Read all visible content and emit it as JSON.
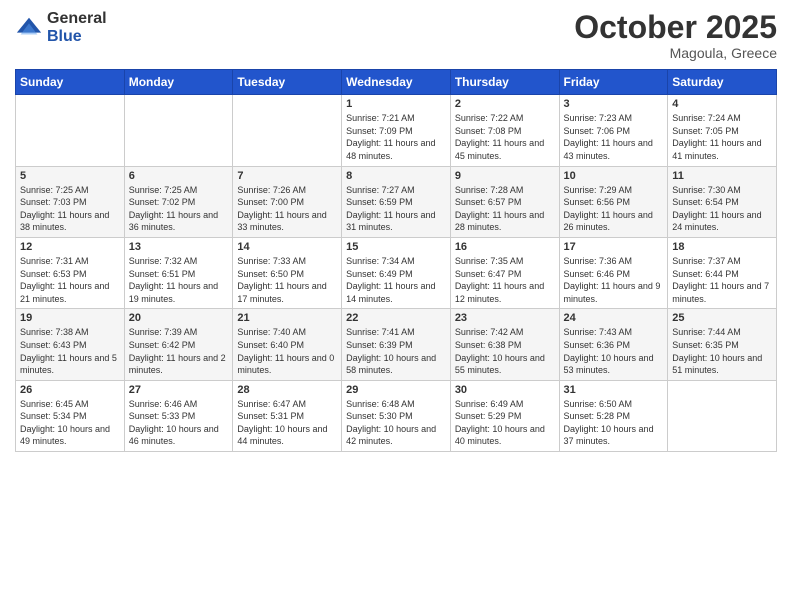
{
  "logo": {
    "general": "General",
    "blue": "Blue"
  },
  "header": {
    "month": "October 2025",
    "location": "Magoula, Greece"
  },
  "weekdays": [
    "Sunday",
    "Monday",
    "Tuesday",
    "Wednesday",
    "Thursday",
    "Friday",
    "Saturday"
  ],
  "weeks": [
    [
      {
        "day": "",
        "info": ""
      },
      {
        "day": "",
        "info": ""
      },
      {
        "day": "",
        "info": ""
      },
      {
        "day": "1",
        "info": "Sunrise: 7:21 AM\nSunset: 7:09 PM\nDaylight: 11 hours and 48 minutes."
      },
      {
        "day": "2",
        "info": "Sunrise: 7:22 AM\nSunset: 7:08 PM\nDaylight: 11 hours and 45 minutes."
      },
      {
        "day": "3",
        "info": "Sunrise: 7:23 AM\nSunset: 7:06 PM\nDaylight: 11 hours and 43 minutes."
      },
      {
        "day": "4",
        "info": "Sunrise: 7:24 AM\nSunset: 7:05 PM\nDaylight: 11 hours and 41 minutes."
      }
    ],
    [
      {
        "day": "5",
        "info": "Sunrise: 7:25 AM\nSunset: 7:03 PM\nDaylight: 11 hours and 38 minutes."
      },
      {
        "day": "6",
        "info": "Sunrise: 7:25 AM\nSunset: 7:02 PM\nDaylight: 11 hours and 36 minutes."
      },
      {
        "day": "7",
        "info": "Sunrise: 7:26 AM\nSunset: 7:00 PM\nDaylight: 11 hours and 33 minutes."
      },
      {
        "day": "8",
        "info": "Sunrise: 7:27 AM\nSunset: 6:59 PM\nDaylight: 11 hours and 31 minutes."
      },
      {
        "day": "9",
        "info": "Sunrise: 7:28 AM\nSunset: 6:57 PM\nDaylight: 11 hours and 28 minutes."
      },
      {
        "day": "10",
        "info": "Sunrise: 7:29 AM\nSunset: 6:56 PM\nDaylight: 11 hours and 26 minutes."
      },
      {
        "day": "11",
        "info": "Sunrise: 7:30 AM\nSunset: 6:54 PM\nDaylight: 11 hours and 24 minutes."
      }
    ],
    [
      {
        "day": "12",
        "info": "Sunrise: 7:31 AM\nSunset: 6:53 PM\nDaylight: 11 hours and 21 minutes."
      },
      {
        "day": "13",
        "info": "Sunrise: 7:32 AM\nSunset: 6:51 PM\nDaylight: 11 hours and 19 minutes."
      },
      {
        "day": "14",
        "info": "Sunrise: 7:33 AM\nSunset: 6:50 PM\nDaylight: 11 hours and 17 minutes."
      },
      {
        "day": "15",
        "info": "Sunrise: 7:34 AM\nSunset: 6:49 PM\nDaylight: 11 hours and 14 minutes."
      },
      {
        "day": "16",
        "info": "Sunrise: 7:35 AM\nSunset: 6:47 PM\nDaylight: 11 hours and 12 minutes."
      },
      {
        "day": "17",
        "info": "Sunrise: 7:36 AM\nSunset: 6:46 PM\nDaylight: 11 hours and 9 minutes."
      },
      {
        "day": "18",
        "info": "Sunrise: 7:37 AM\nSunset: 6:44 PM\nDaylight: 11 hours and 7 minutes."
      }
    ],
    [
      {
        "day": "19",
        "info": "Sunrise: 7:38 AM\nSunset: 6:43 PM\nDaylight: 11 hours and 5 minutes."
      },
      {
        "day": "20",
        "info": "Sunrise: 7:39 AM\nSunset: 6:42 PM\nDaylight: 11 hours and 2 minutes."
      },
      {
        "day": "21",
        "info": "Sunrise: 7:40 AM\nSunset: 6:40 PM\nDaylight: 11 hours and 0 minutes."
      },
      {
        "day": "22",
        "info": "Sunrise: 7:41 AM\nSunset: 6:39 PM\nDaylight: 10 hours and 58 minutes."
      },
      {
        "day": "23",
        "info": "Sunrise: 7:42 AM\nSunset: 6:38 PM\nDaylight: 10 hours and 55 minutes."
      },
      {
        "day": "24",
        "info": "Sunrise: 7:43 AM\nSunset: 6:36 PM\nDaylight: 10 hours and 53 minutes."
      },
      {
        "day": "25",
        "info": "Sunrise: 7:44 AM\nSunset: 6:35 PM\nDaylight: 10 hours and 51 minutes."
      }
    ],
    [
      {
        "day": "26",
        "info": "Sunrise: 6:45 AM\nSunset: 5:34 PM\nDaylight: 10 hours and 49 minutes."
      },
      {
        "day": "27",
        "info": "Sunrise: 6:46 AM\nSunset: 5:33 PM\nDaylight: 10 hours and 46 minutes."
      },
      {
        "day": "28",
        "info": "Sunrise: 6:47 AM\nSunset: 5:31 PM\nDaylight: 10 hours and 44 minutes."
      },
      {
        "day": "29",
        "info": "Sunrise: 6:48 AM\nSunset: 5:30 PM\nDaylight: 10 hours and 42 minutes."
      },
      {
        "day": "30",
        "info": "Sunrise: 6:49 AM\nSunset: 5:29 PM\nDaylight: 10 hours and 40 minutes."
      },
      {
        "day": "31",
        "info": "Sunrise: 6:50 AM\nSunset: 5:28 PM\nDaylight: 10 hours and 37 minutes."
      },
      {
        "day": "",
        "info": ""
      }
    ]
  ]
}
